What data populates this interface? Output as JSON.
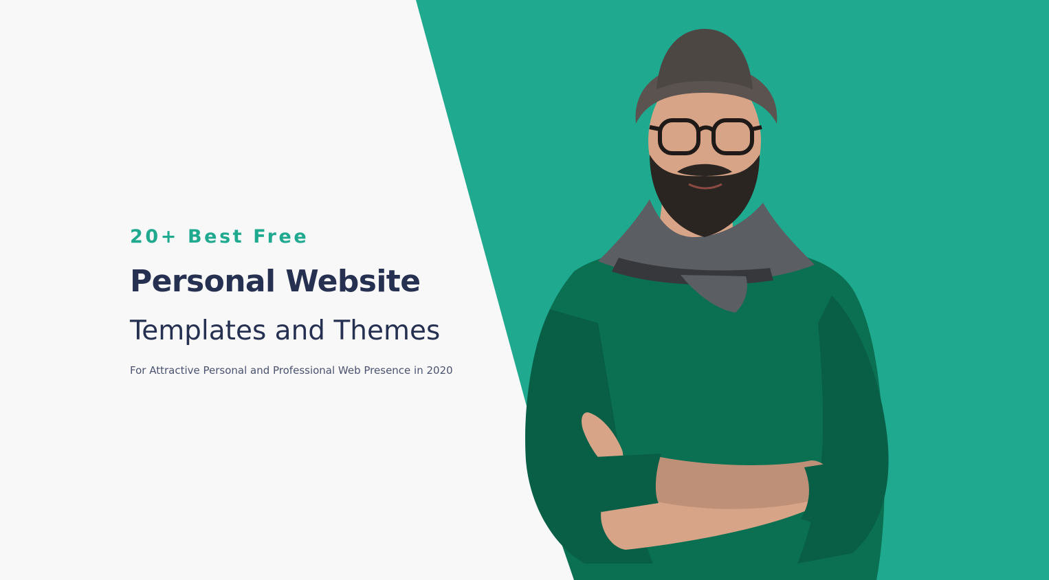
{
  "hero": {
    "eyebrow": "20+ Best Free",
    "headline": "Personal Website",
    "subheadline": "Templates and Themes",
    "tagline": "For Attractive Personal and Professional Web Presence in 2020"
  },
  "colors": {
    "accent": "#1fa98f",
    "heading": "#263152",
    "tagline": "#4b5270",
    "background": "#f8f8f9",
    "sweater": "#0b7052",
    "skin": "#d8a487",
    "beard": "#2b2522",
    "hat": "#5a5350",
    "scarf": "#5b5e62"
  },
  "illustration": {
    "subject": "man-with-hat-glasses-beard-scarf-green-sweater-arms-crossed"
  }
}
